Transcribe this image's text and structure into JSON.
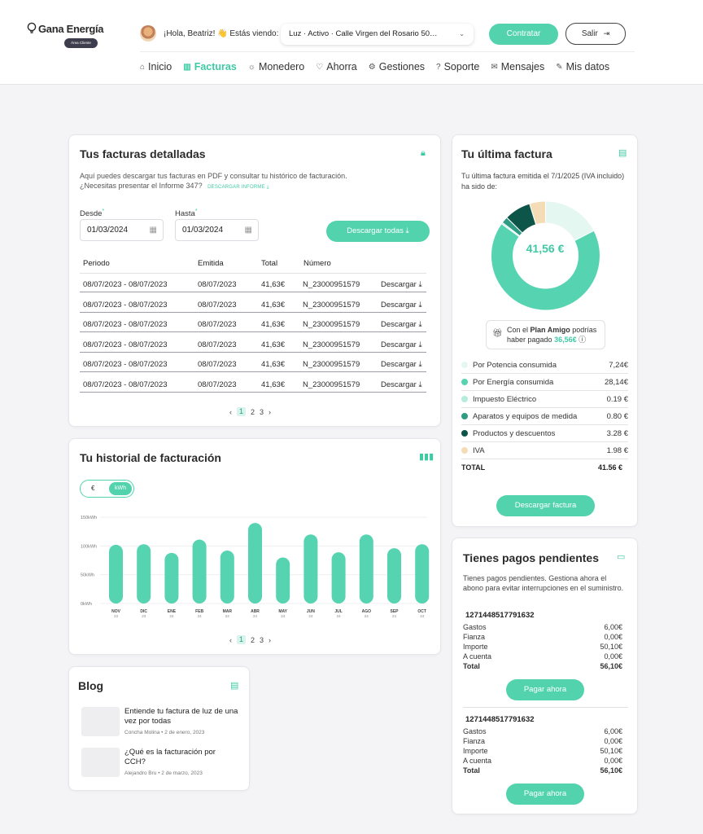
{
  "header": {
    "brand": "Gana Energía",
    "brand_badge": "Área Cliente",
    "greeting": "¡Hola, Beatriz! 👋 Estás viendo:",
    "supply": "Luz · Activo · Calle Virgen del Rosario 50…",
    "contratar": "Contratar",
    "salir": "Salir"
  },
  "nav": [
    {
      "label": "Inicio",
      "icon": "home-icon",
      "glyph": "⌂"
    },
    {
      "label": "Facturas",
      "icon": "bars-icon",
      "glyph": "▥",
      "active": true
    },
    {
      "label": "Monedero",
      "icon": "sun-icon",
      "glyph": "☼"
    },
    {
      "label": "Ahorra",
      "icon": "leaf-icon",
      "glyph": "♡"
    },
    {
      "label": "Gestiones",
      "icon": "gear-icon",
      "glyph": "⚙"
    },
    {
      "label": "Soporte",
      "icon": "help-icon",
      "glyph": "?"
    },
    {
      "label": "Mensajes",
      "icon": "mail-icon",
      "glyph": "✉"
    },
    {
      "label": "Mis datos",
      "icon": "edit-icon",
      "glyph": "✎"
    }
  ],
  "facturas": {
    "title": "Tus facturas detalladas",
    "desc": "Aquí puedes descargar tus facturas en PDF y consultar tu histórico de facturación. ¿Necesitas presentar el Informe 347?",
    "link": "DESCARGAR INFORME ⤓",
    "desde_label": "Desde",
    "hasta_label": "Hasta",
    "desde_value": "01/03/2024",
    "hasta_value": "01/03/2024",
    "download_all": "Descargar todas ⤓",
    "columns": [
      "Periodo",
      "Emitida",
      "Total",
      "Número"
    ],
    "rows": [
      {
        "periodo": "08/07/2023 - 08/07/2023",
        "emitida": "08/07/2023",
        "total": "41,63€",
        "numero": "N_23000951579",
        "accion": "Descargar ⤓"
      },
      {
        "periodo": "08/07/2023 - 08/07/2023",
        "emitida": "08/07/2023",
        "total": "41,63€",
        "numero": "N_23000951579",
        "accion": "Descargar ⤓"
      },
      {
        "periodo": "08/07/2023 - 08/07/2023",
        "emitida": "08/07/2023",
        "total": "41,63€",
        "numero": "N_23000951579",
        "accion": "Descargar ⤓"
      },
      {
        "periodo": "08/07/2023 - 08/07/2023",
        "emitida": "08/07/2023",
        "total": "41,63€",
        "numero": "N_23000951579",
        "accion": "Descargar ⤓"
      },
      {
        "periodo": "08/07/2023 - 08/07/2023",
        "emitida": "08/07/2023",
        "total": "41,63€",
        "numero": "N_23000951579",
        "accion": "Descargar ⤓"
      },
      {
        "periodo": "08/07/2023 - 08/07/2023",
        "emitida": "08/07/2023",
        "total": "41,63€",
        "numero": "N_23000951579",
        "accion": "Descargar ⤓"
      }
    ],
    "pages": [
      "1",
      "2",
      "3"
    ]
  },
  "historial": {
    "title": "Tu historial de facturación",
    "toggle_eur": "€",
    "toggle_kwh": "kWh",
    "pages": [
      "1",
      "2",
      "3"
    ]
  },
  "chart_data": {
    "type": "bar",
    "categories": [
      "NOV 23",
      "DIC 23",
      "ENE 24",
      "FEB 24",
      "MAR 24",
      "ABR 24",
      "MAY 24",
      "JUN 24",
      "JUL 24",
      "AGO 24",
      "SEP 24",
      "OCT 24"
    ],
    "months": [
      "NOV",
      "DIC",
      "ENE",
      "FEB",
      "MAR",
      "ABR",
      "MAY",
      "JUN",
      "JUL",
      "AGO",
      "SEP",
      "OCT"
    ],
    "years": [
      "23",
      "23",
      "24",
      "24",
      "24",
      "24",
      "24",
      "24",
      "24",
      "24",
      "24",
      "24"
    ],
    "values": [
      102,
      103,
      88,
      111,
      92,
      140,
      80,
      120,
      89,
      120,
      96,
      103
    ],
    "yticks": [
      "0kWh",
      "50kWh",
      "100kWh",
      "150kWh"
    ],
    "ytick_values": [
      0,
      50,
      100,
      150
    ],
    "ylim": [
      0,
      150
    ],
    "color": "#56d4b1"
  },
  "ultima": {
    "title": "Tu última factura",
    "desc": "Tu última factura emitida el 7/1/2025 (IVA incluido) ha sido de:",
    "amount": "41,56 €",
    "amigo_pre": "Con el ",
    "amigo_bold": "Plan Amigo",
    "amigo_post": " podrías haber pagado ",
    "amigo_amount": "36,56€",
    "amigo_info": "ⓘ",
    "donut": [
      {
        "label": "Por Potencia consumida",
        "value": 7.24,
        "text": "7,24€",
        "color": "#e5f7f1"
      },
      {
        "label": "Por Energía consumida",
        "value": 28.14,
        "text": "28,14€",
        "color": "#56d4b1"
      },
      {
        "label": "Impuesto Eléctrico",
        "value": 0.19,
        "text": "0.19 €",
        "color": "#b5ecdc"
      },
      {
        "label": "Aparatos y equipos de medida",
        "value": 0.8,
        "text": "0.80 €",
        "color": "#2f9b83"
      },
      {
        "label": "Productos y descuentos",
        "value": 3.28,
        "text": "3.28 €",
        "color": "#0d5548"
      },
      {
        "label": "IVA",
        "value": 1.98,
        "text": "1.98 €",
        "color": "#f4dcb7"
      }
    ],
    "total_label": "TOTAL",
    "total_value": "41.56 €",
    "download": "Descargar factura"
  },
  "pagos": {
    "title": "Tienes pagos pendientes",
    "desc": "Tienes pagos pendientes. Gestiona ahora el abono para evitar interrupciones en el suministro.",
    "items": [
      {
        "id": "1271448517791632",
        "lines": [
          [
            "Gastos",
            "6,00€"
          ],
          [
            "Fianza",
            "0,00€"
          ],
          [
            "Importe",
            "50,10€"
          ],
          [
            "A cuenta",
            "0,00€"
          ]
        ],
        "total": [
          "Total",
          "56,10€"
        ],
        "button": "Pagar ahora"
      },
      {
        "id": "1271448517791632",
        "lines": [
          [
            "Gastos",
            "6,00€"
          ],
          [
            "Fianza",
            "0,00€"
          ],
          [
            "Importe",
            "50,10€"
          ],
          [
            "A cuenta",
            "0,00€"
          ]
        ],
        "total": [
          "Total",
          "56,10€"
        ],
        "button": "Pagar ahora"
      }
    ]
  },
  "blog": {
    "title": "Blog",
    "posts": [
      {
        "title": "Entiende tu factura de luz de una vez por todas",
        "author": "Concha Molina",
        "date": "2 de enero, 2023"
      },
      {
        "title": "¿Qué es la facturación por CCH?",
        "author": "Alejandro Bru",
        "date": "2 de marzo, 2023"
      }
    ]
  }
}
